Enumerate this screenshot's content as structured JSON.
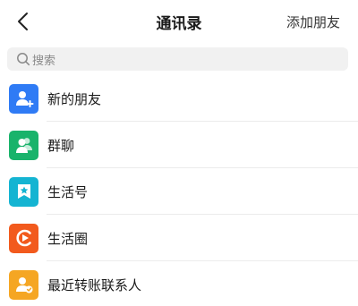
{
  "header": {
    "back_icon": "chevron-left-icon",
    "title": "通讯录",
    "add_friend": "添加朋友"
  },
  "search": {
    "icon": "search-icon",
    "placeholder": "搜索"
  },
  "list": {
    "items": [
      {
        "label": "新的朋友",
        "icon": "add-user-icon",
        "color": "#2f7bf5"
      },
      {
        "label": "群聊",
        "icon": "group-icon",
        "color": "#19b36b"
      },
      {
        "label": "生活号",
        "icon": "star-bookmark-icon",
        "color": "#14b4d2"
      },
      {
        "label": "生活圈",
        "icon": "play-circle-icon",
        "color": "#f25a1d"
      },
      {
        "label": "最近转账联系人",
        "icon": "user-check-icon",
        "color": "#f5a623"
      }
    ]
  }
}
